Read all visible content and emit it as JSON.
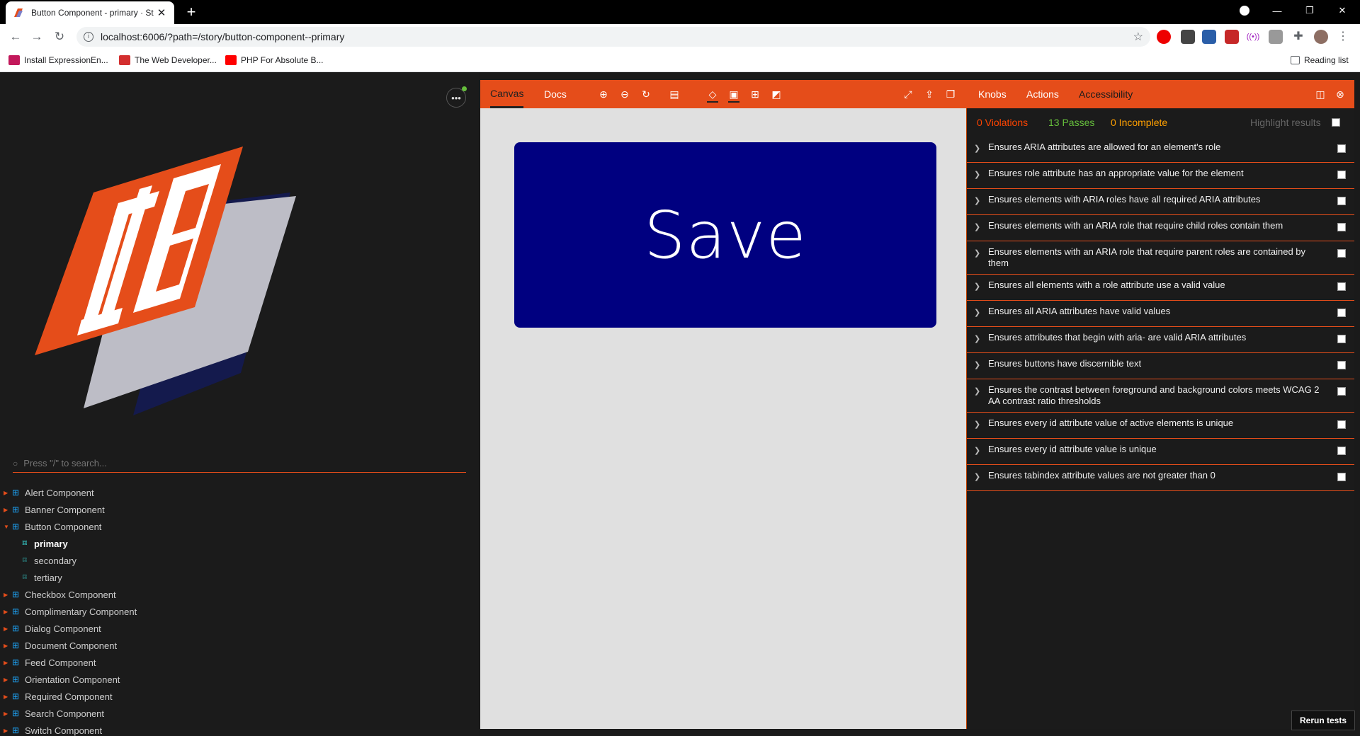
{
  "browser": {
    "tab_title": "Button Component - primary · St",
    "url": "localhost:6006/?path=/story/button-component--primary",
    "bookmarks": [
      {
        "label": "Install ExpressionEn...",
        "color": "#c2185b"
      },
      {
        "label": "The Web Developer...",
        "color": "#d32f2f"
      },
      {
        "label": "PHP For Absolute B...",
        "color": "#ff0000"
      }
    ],
    "reading_list": "Reading list"
  },
  "sidebar": {
    "search_placeholder": "Press \"/\" to search...",
    "tree": [
      {
        "label": "Alert Component",
        "type": "component"
      },
      {
        "label": "Banner Component",
        "type": "component"
      },
      {
        "label": "Button Component",
        "type": "component",
        "expanded": true
      },
      {
        "label": "primary",
        "type": "story",
        "selected": true
      },
      {
        "label": "secondary",
        "type": "story"
      },
      {
        "label": "tertiary",
        "type": "story"
      },
      {
        "label": "Checkbox Component",
        "type": "component"
      },
      {
        "label": "Complimentary Component",
        "type": "component"
      },
      {
        "label": "Dialog Component",
        "type": "component"
      },
      {
        "label": "Document Component",
        "type": "component"
      },
      {
        "label": "Feed Component",
        "type": "component"
      },
      {
        "label": "Orientation Component",
        "type": "component"
      },
      {
        "label": "Required Component",
        "type": "component"
      },
      {
        "label": "Search Component",
        "type": "component"
      },
      {
        "label": "Switch Component",
        "type": "component"
      }
    ]
  },
  "toolbar": {
    "tabs": {
      "canvas": "Canvas",
      "docs": "Docs"
    }
  },
  "addons": {
    "tabs": {
      "knobs": "Knobs",
      "actions": "Actions",
      "accessibility": "Accessibility"
    }
  },
  "preview": {
    "button_label": "Save",
    "button_color": "#000080"
  },
  "accessibility": {
    "violations": "0 Violations",
    "passes": "13 Passes",
    "incomplete": "0 Incomplete",
    "highlight": "Highlight results",
    "rules": [
      "Ensures ARIA attributes are allowed for an element's role",
      "Ensures role attribute has an appropriate value for the element",
      "Ensures elements with ARIA roles have all required ARIA attributes",
      "Ensures elements with an ARIA role that require child roles contain them",
      "Ensures elements with an ARIA role that require parent roles are contained by them",
      "Ensures all elements with a role attribute use a valid value",
      "Ensures all ARIA attributes have valid values",
      "Ensures attributes that begin with aria- are valid ARIA attributes",
      "Ensures buttons have discernible text",
      "Ensures the contrast between foreground and background colors meets WCAG 2 AA contrast ratio thresholds",
      "Ensures every id attribute value of active elements is unique",
      "Ensures every id attribute value is unique",
      "Ensures tabindex attribute values are not greater than 0"
    ],
    "rerun": "Rerun tests"
  },
  "colors": {
    "accent": "#e54d1a",
    "violations": "#ff4400",
    "passes": "#66bf3c",
    "incomplete": "#ffa000"
  }
}
